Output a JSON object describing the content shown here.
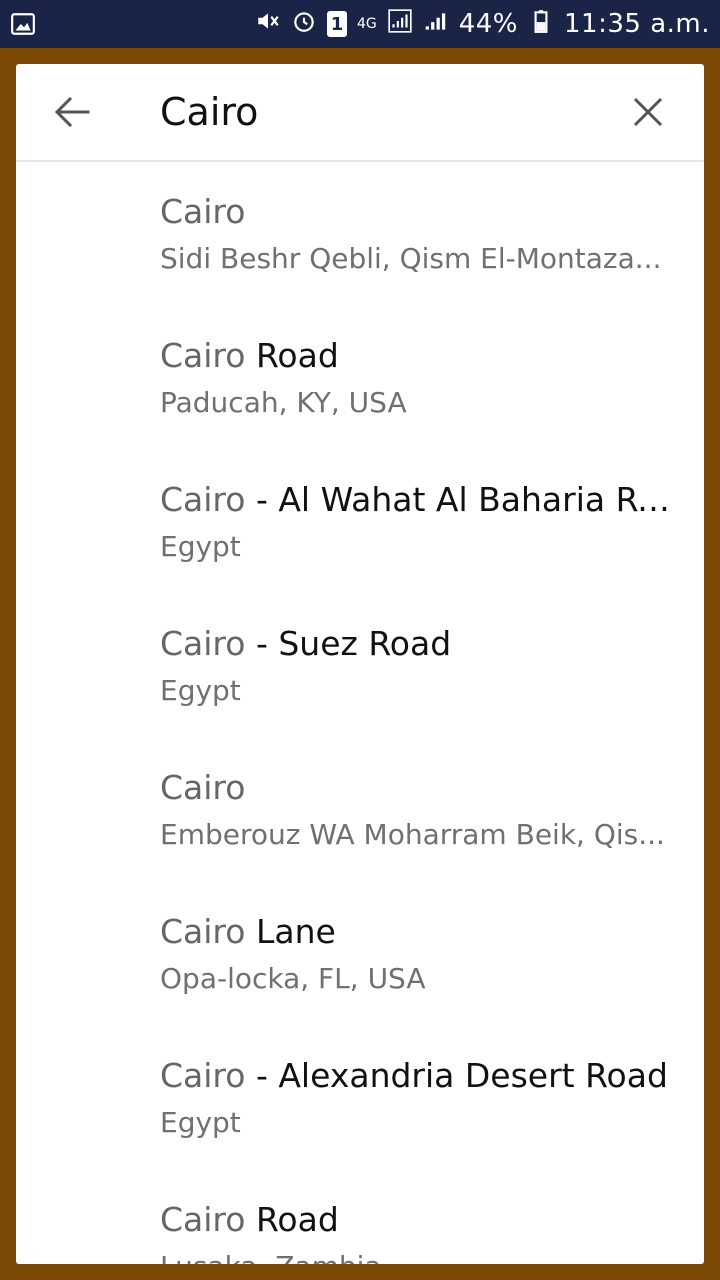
{
  "status_bar": {
    "battery": "44%",
    "time": "11:35 a.m.",
    "network": "4G",
    "sim": "1",
    "icons": [
      "gallery-icon",
      "mute-icon",
      "alarm-icon",
      "sim-icon",
      "4g-icon",
      "signal-icon",
      "battery-icon"
    ]
  },
  "search": {
    "value": "Cairo",
    "back_icon": "arrow-left-icon",
    "clear_icon": "close-icon"
  },
  "results": [
    {
      "match": "Cairo",
      "rest": "",
      "subtitle": "Sidi Beshr Qebli, Qism El-Montaza..."
    },
    {
      "match": "Cairo",
      "rest": " Road",
      "subtitle": "Paducah, KY, USA"
    },
    {
      "match": "Cairo",
      "rest": " - Al Wahat Al Baharia Ro...",
      "subtitle": "Egypt"
    },
    {
      "match": "Cairo",
      "rest": " - Suez Road",
      "subtitle": "Egypt"
    },
    {
      "match": "Cairo",
      "rest": "",
      "subtitle": "Emberouz WA Moharram Beik, Qis..."
    },
    {
      "match": "Cairo",
      "rest": " Lane",
      "subtitle": "Opa-locka, FL, USA"
    },
    {
      "match": "Cairo",
      "rest": " - Alexandria Desert Road",
      "subtitle": "Egypt"
    },
    {
      "match": "Cairo",
      "rest": " Road",
      "subtitle": "Lusaka, Zambia"
    }
  ],
  "colors": {
    "status_bar": "#1a2447",
    "backdrop": "#7a4a06",
    "panel": "#ffffff",
    "title_text": "#111111",
    "match_text": "#666666",
    "subtitle_text": "#707070"
  }
}
